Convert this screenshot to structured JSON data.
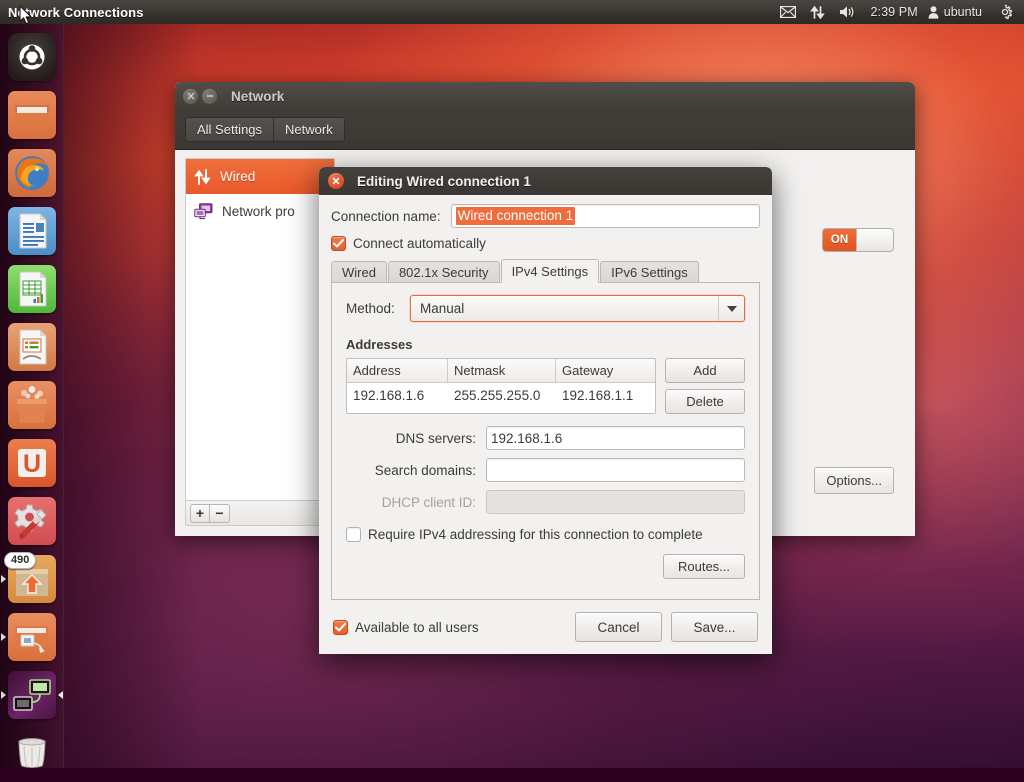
{
  "panel": {
    "title": "Network Connections",
    "clock": "2:39 PM",
    "user": "ubuntu",
    "icons": {
      "mail": "mail-icon",
      "network": "network-updown-icon",
      "sound": "volume-icon",
      "user": "user-icon",
      "session": "gear-session-icon"
    }
  },
  "launcher": {
    "items": [
      {
        "name": "ubuntu-dash-home",
        "label": "Dash home",
        "badge": null
      },
      {
        "name": "files-nautilus",
        "label": "Files",
        "badge": null
      },
      {
        "name": "firefox",
        "label": "Firefox Web Browser",
        "badge": null
      },
      {
        "name": "libreoffice-writer",
        "label": "LibreOffice Writer",
        "badge": null
      },
      {
        "name": "libreoffice-calc",
        "label": "LibreOffice Calc",
        "badge": null
      },
      {
        "name": "libreoffice-impress",
        "label": "LibreOffice Impress",
        "badge": null
      },
      {
        "name": "ubuntu-software-center",
        "label": "Ubuntu Software Center",
        "badge": null
      },
      {
        "name": "ubuntu-one",
        "label": "Ubuntu One",
        "badge": null
      },
      {
        "name": "system-settings",
        "label": "System Settings",
        "badge": null
      },
      {
        "name": "software-updater",
        "label": "Software Updater",
        "badge": "490"
      },
      {
        "name": "network-connections",
        "label": "Network Connections",
        "badge": null
      },
      {
        "name": "workspace-switcher",
        "label": "Workspace Switcher",
        "badge": null
      },
      {
        "name": "trash",
        "label": "Trash",
        "badge": null
      }
    ]
  },
  "network_window": {
    "title": "Network",
    "breadcrumbs": [
      "All Settings",
      "Network"
    ],
    "list": [
      {
        "label": "Wired",
        "icon": "network-updown-icon",
        "selected": true
      },
      {
        "label": "Network pro",
        "icon": "network-proxy-icon",
        "selected": false
      }
    ],
    "list_toolbar": {
      "add": "+",
      "remove": "−"
    },
    "toggle": {
      "state": "ON"
    },
    "options_label": "Options..."
  },
  "dialog": {
    "title": "Editing Wired connection 1",
    "connection_name_label": "Connection name:",
    "connection_name_value": "Wired connection 1",
    "connection_name_selected": true,
    "connect_automatically_label": "Connect automatically",
    "connect_automatically_checked": true,
    "tabs": [
      {
        "label": "Wired",
        "active": false
      },
      {
        "label": "802.1x Security",
        "active": false
      },
      {
        "label": "IPv4 Settings",
        "active": true
      },
      {
        "label": "IPv6 Settings",
        "active": false
      }
    ],
    "method_label": "Method:",
    "method_value": "Manual",
    "addresses_title": "Addresses",
    "addresses_columns": [
      "Address",
      "Netmask",
      "Gateway"
    ],
    "addresses_rows": [
      [
        "192.168.1.6",
        "255.255.255.0",
        "192.168.1.1"
      ]
    ],
    "add_label": "Add",
    "delete_label": "Delete",
    "dns_label": "DNS servers:",
    "dns_value": "192.168.1.6",
    "search_domains_label": "Search domains:",
    "search_domains_value": "",
    "dhcp_label": "DHCP client ID:",
    "dhcp_value": "",
    "dhcp_disabled": true,
    "require_ipv4_label": "Require IPv4 addressing for this connection to complete",
    "require_ipv4_checked": false,
    "routes_label": "Routes...",
    "available_all_users_label": "Available to all users",
    "available_all_users_checked": true,
    "cancel_label": "Cancel",
    "save_label": "Save..."
  },
  "colors": {
    "ubuntu_orange": "#e8582a",
    "selection_orange": "#ef6d3d",
    "panel_dark": "#3c3833",
    "window_bg": "#f2f1f0",
    "text": "#3c3b37"
  }
}
